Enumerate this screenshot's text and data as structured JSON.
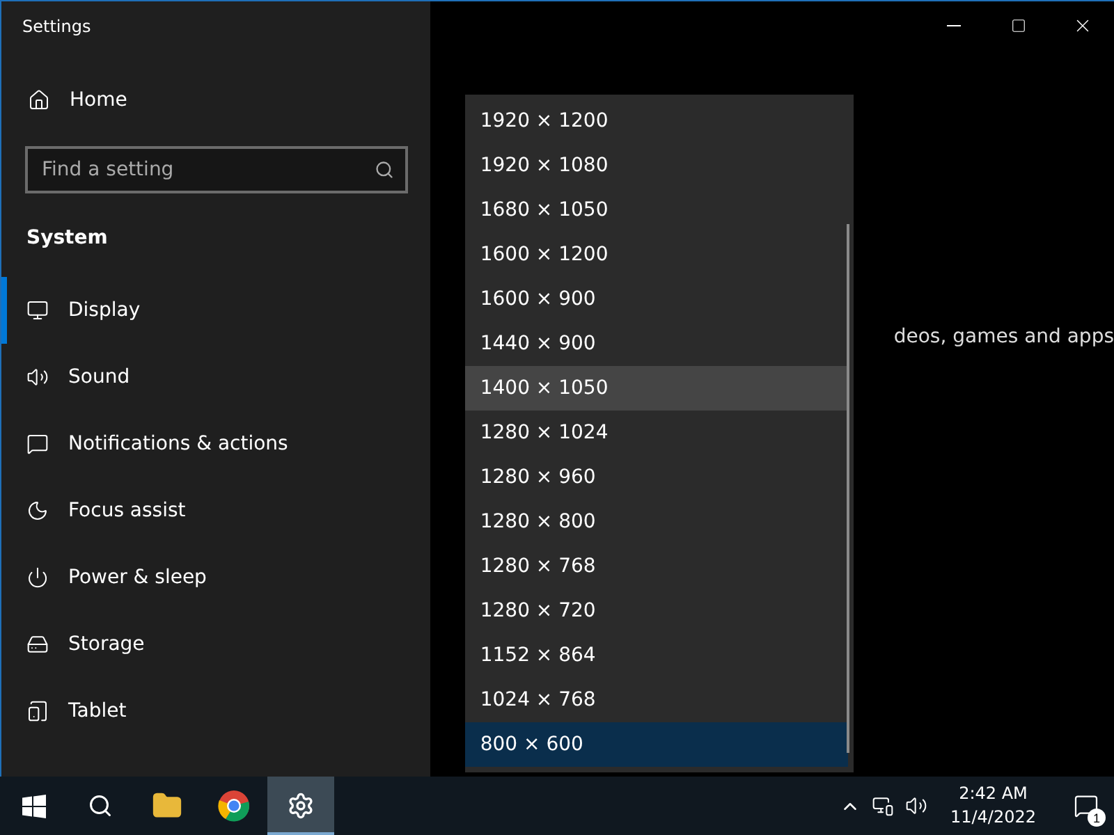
{
  "window": {
    "title": "Settings"
  },
  "sidebar": {
    "home": "Home",
    "search": {
      "placeholder": "Find a setting"
    },
    "section": "System",
    "items": [
      {
        "label": "Display",
        "selected": true
      },
      {
        "label": "Sound",
        "selected": false
      },
      {
        "label": "Notifications & actions",
        "selected": false
      },
      {
        "label": "Focus assist",
        "selected": false
      },
      {
        "label": "Power & sleep",
        "selected": false
      },
      {
        "label": "Storage",
        "selected": false
      },
      {
        "label": "Tablet",
        "selected": false
      }
    ]
  },
  "content": {
    "partial_text": "deos, games and apps"
  },
  "dropdown": {
    "options": [
      {
        "label": "1920 × 1200",
        "hovered": false,
        "selected": false
      },
      {
        "label": "1920 × 1080",
        "hovered": false,
        "selected": false
      },
      {
        "label": "1680 × 1050",
        "hovered": false,
        "selected": false
      },
      {
        "label": "1600 × 1200",
        "hovered": false,
        "selected": false
      },
      {
        "label": "1600 × 900",
        "hovered": false,
        "selected": false
      },
      {
        "label": "1440 × 900",
        "hovered": false,
        "selected": false
      },
      {
        "label": "1400 × 1050",
        "hovered": true,
        "selected": false
      },
      {
        "label": "1280 × 1024",
        "hovered": false,
        "selected": false
      },
      {
        "label": "1280 × 960",
        "hovered": false,
        "selected": false
      },
      {
        "label": "1280 × 800",
        "hovered": false,
        "selected": false
      },
      {
        "label": "1280 × 768",
        "hovered": false,
        "selected": false
      },
      {
        "label": "1280 × 720",
        "hovered": false,
        "selected": false
      },
      {
        "label": "1152 × 864",
        "hovered": false,
        "selected": false
      },
      {
        "label": "1024 × 768",
        "hovered": false,
        "selected": false
      },
      {
        "label": "800 × 600",
        "hovered": false,
        "selected": true
      }
    ]
  },
  "taskbar": {
    "apps": [
      {
        "active": false
      },
      {
        "active": false
      },
      {
        "active": false
      },
      {
        "active": true
      }
    ],
    "time": "2:42 AM",
    "date": "11/4/2022",
    "notification_count": "1"
  }
}
